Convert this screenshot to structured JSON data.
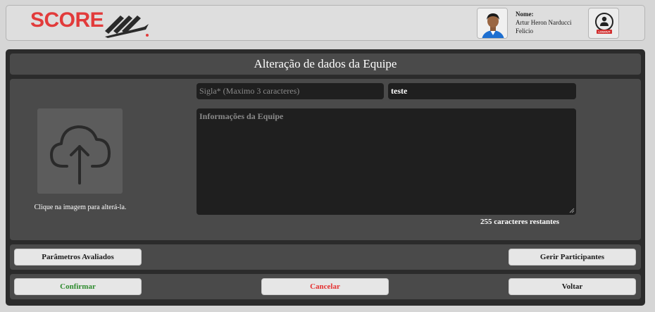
{
  "header": {
    "logo_text": "SCORE",
    "user_label": "Nome:",
    "user_name": "Artur Heron Narducci Felicio",
    "logout_label": "LOGOUT"
  },
  "panel": {
    "title": "Alteração de dados da Equipe"
  },
  "form": {
    "upload_caption": "Clique na imagem para alterá-la.",
    "sigla_placeholder": "Sigla* (Maximo 3 caracteres)",
    "sigla_value": "teste",
    "info_placeholder": "Informações da Equipe",
    "chars_remaining": "255 caracteres restantes"
  },
  "buttons": {
    "parametros": "Parâmetros Avaliados",
    "gerir": "Gerir Participantes",
    "confirmar": "Confirmar",
    "cancelar": "Cancelar",
    "voltar": "Voltar"
  },
  "colors": {
    "brand_red": "#e23b3b",
    "confirm_green": "#2e8b2e",
    "cancel_red": "#e53030"
  }
}
